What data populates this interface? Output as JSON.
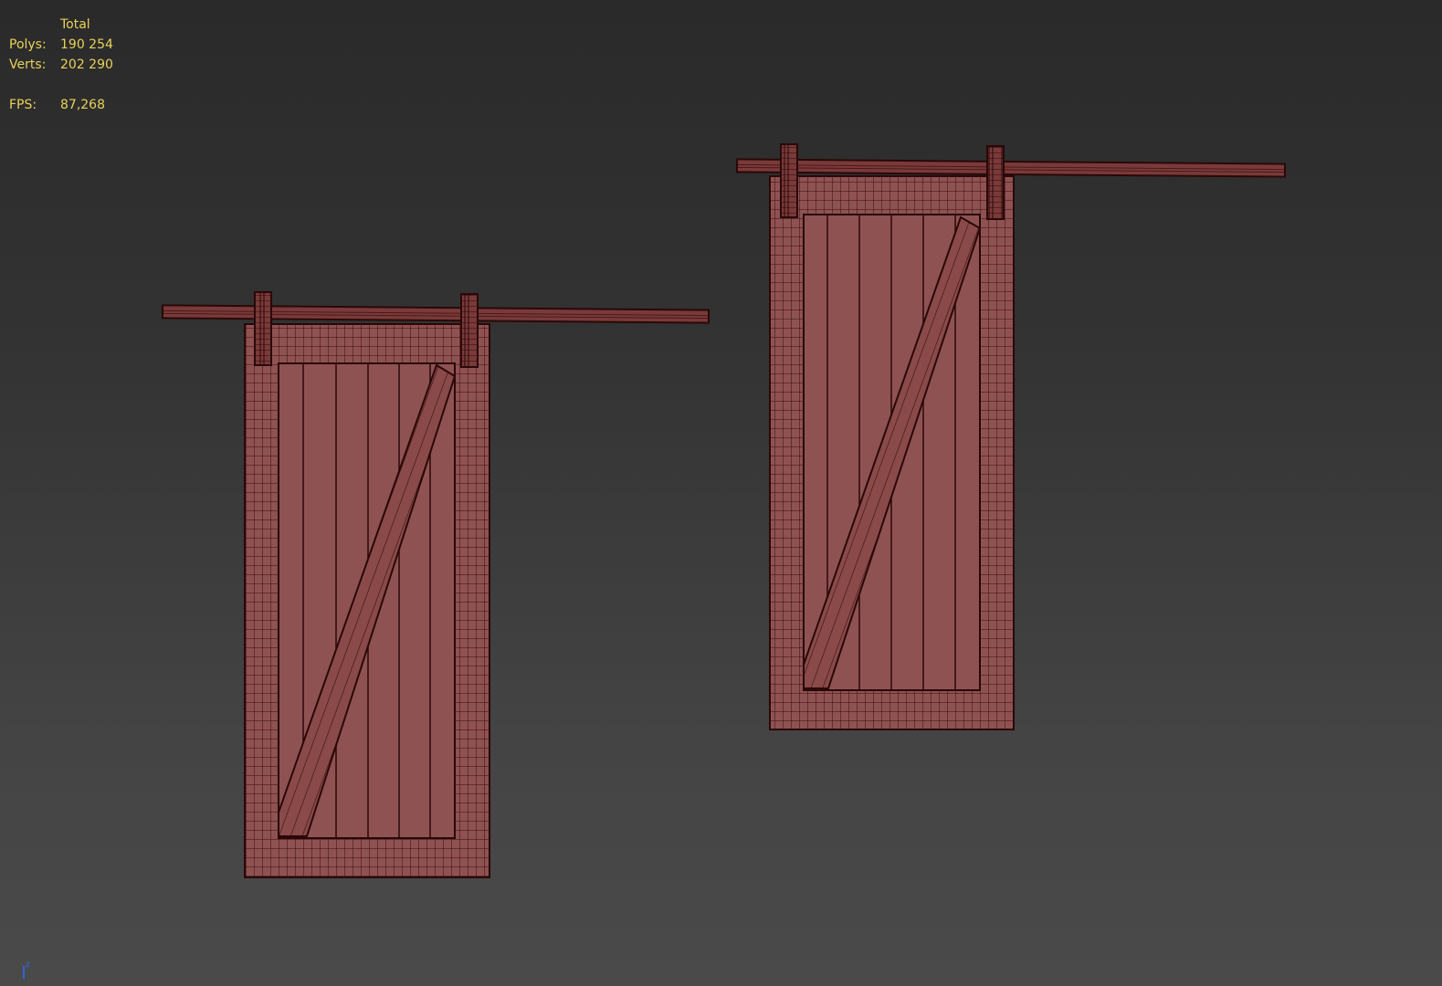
{
  "viewport": {
    "background_top": "#2a2a2a",
    "background_bottom": "#4a4a4a"
  },
  "stats": {
    "header": "Total",
    "polys_label": "Polys:",
    "polys_value": "190 254",
    "verts_label": "Verts:",
    "verts_value": "202 290",
    "fps_label": "FPS:",
    "fps_value": "87,268",
    "color": "#e8d25a"
  },
  "scene": {
    "objects": [
      "barn-door-left",
      "barn-door-right"
    ],
    "wireframe_color": "#3a0c0c",
    "face_color": "#8f5252"
  },
  "axis_gizmo": {
    "axis_label": "z",
    "axis_color": "#2b6cff"
  }
}
